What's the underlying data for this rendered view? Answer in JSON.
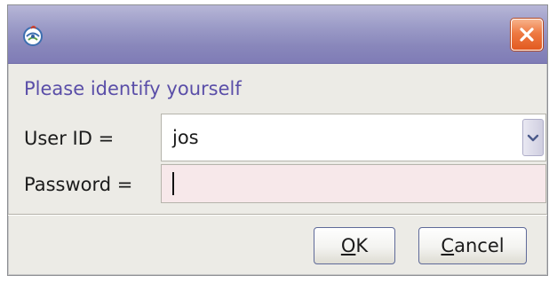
{
  "window": {
    "title": "",
    "icon": "java-app-icon",
    "close_icon": "close-icon"
  },
  "prompt": "Please identify yourself",
  "fields": {
    "userid": {
      "label": "User ID =",
      "value": "jos"
    },
    "password": {
      "label": "Password =",
      "value": ""
    }
  },
  "buttons": {
    "ok": {
      "mnemonic": "O",
      "rest": "K"
    },
    "cancel": {
      "mnemonic": "C",
      "rest": "ancel"
    }
  },
  "colors": {
    "titlebar": "#8987bb",
    "prompt_text": "#5a4ea8",
    "close_button": "#e25a20",
    "password_background": "#f7e8ea",
    "dialog_background": "#ecebe6"
  }
}
